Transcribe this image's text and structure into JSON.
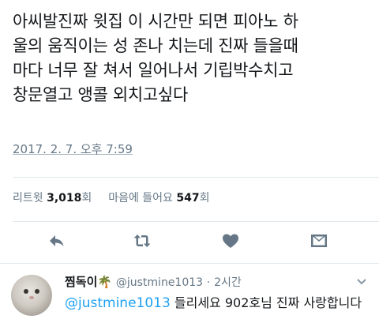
{
  "tweet": {
    "text": "아씨발진짜 윗집 이 시간만 되면 피아노 하\n울의 움직이는 성 존나 치는데 진짜 들을때\n마다 너무 잘 쳐서 일어나서 기립박수치고\n창문열고 앵콜 외치고싶다",
    "timestamp": "2017. 2. 7. 오후 7:59"
  },
  "stats": {
    "retweets_label": "리트윗",
    "retweets_count": "3,018",
    "retweets_unit": "회",
    "likes_label": "마음에 들어요",
    "likes_count": "547",
    "likes_unit": "회"
  },
  "actions": [
    {
      "name": "reply",
      "icon": "reply-icon"
    },
    {
      "name": "retweet",
      "icon": "retweet-icon"
    },
    {
      "name": "like",
      "icon": "heart-icon"
    },
    {
      "name": "message",
      "icon": "envelope-icon"
    }
  ],
  "reply": {
    "name": "찜독이",
    "emoji": "🌴",
    "handle": "@justmine1013",
    "separator": "·",
    "time": "2시간",
    "mention": "@justmine1013",
    "text": " 들리세요 902호님 진짜 사랑합니다"
  },
  "colors": {
    "text": "#14171a",
    "muted": "#657786",
    "link": "#1da1f2",
    "divider": "#e1e8ed"
  }
}
